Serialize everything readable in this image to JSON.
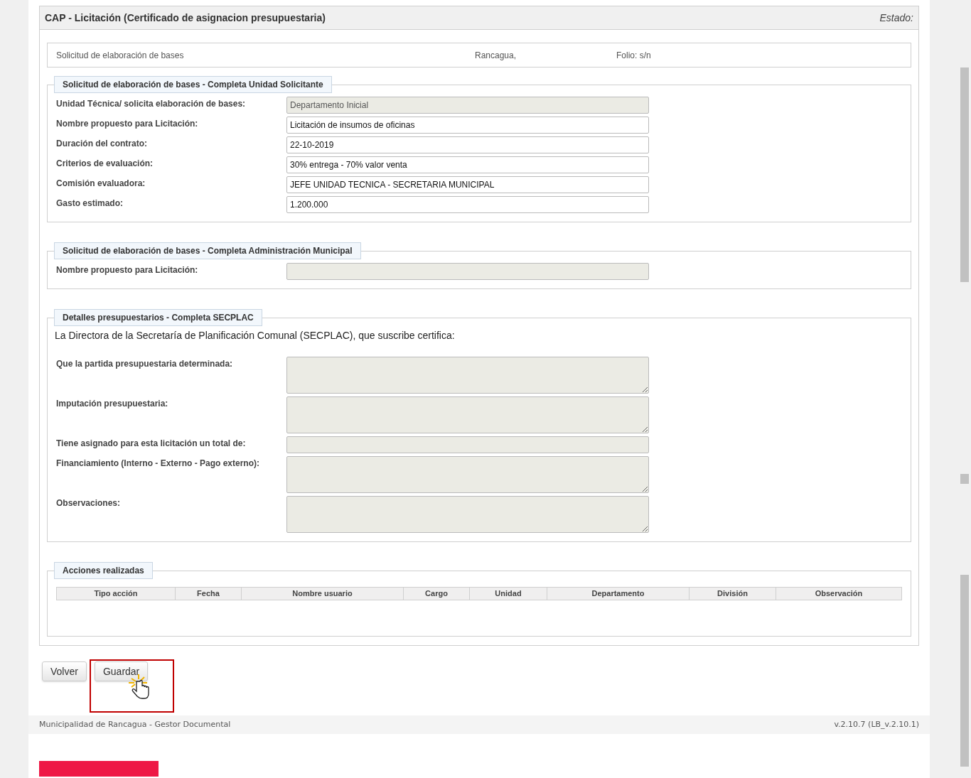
{
  "panel": {
    "title": "CAP - Licitación (Certificado de asignacion presupuestaria)",
    "status_label": "Estado:"
  },
  "header_box": {
    "document": "Solicitud de elaboración de bases",
    "city": "Rancagua,",
    "folio": "Folio: s/n"
  },
  "sections": [
    {
      "legend": "Solicitud de elaboración de bases - Completa Unidad Solicitante",
      "fields": [
        {
          "label": "Unidad Técnica/ solicita elaboración de bases:",
          "kind": "input",
          "disabled": true,
          "value": "Departamento Inicial"
        },
        {
          "label": "Nombre propuesto para Licitación:",
          "kind": "input",
          "disabled": false,
          "value": "Licitación de insumos de oficinas"
        },
        {
          "label": "Duración del contrato:",
          "kind": "input",
          "disabled": false,
          "value": "22-10-2019"
        },
        {
          "label": "Criterios de evaluación:",
          "kind": "input",
          "disabled": false,
          "value": "30% entrega - 70% valor venta"
        },
        {
          "label": "Comisión evaluadora:",
          "kind": "input",
          "disabled": false,
          "value": "JEFE UNIDAD TECNICA - SECRETARIA MUNICIPAL"
        },
        {
          "label": "Gasto estimado:",
          "kind": "input",
          "disabled": false,
          "value": "1.200.000"
        }
      ]
    },
    {
      "legend": "Solicitud de elaboración de bases - Completa Administración Municipal",
      "fields": [
        {
          "label": "Nombre propuesto para Licitación:",
          "kind": "input",
          "disabled": true
        }
      ]
    },
    {
      "legend": "Detalles presupuestarios - Completa SECPLAC",
      "intro": "La Directora de la Secretaría de Planificación Comunal (SECPLAC), que suscribe certifica:",
      "fields": [
        {
          "label": "Que la partida presupuestaria determinada:",
          "kind": "textarea",
          "disabled": true
        },
        {
          "label": "Imputación presupuestaria:",
          "kind": "textarea",
          "disabled": true
        },
        {
          "label": "Tiene asignado para esta licitación un total de:",
          "kind": "input",
          "disabled": true
        },
        {
          "label": "Financiamiento (Interno - Externo - Pago externo):",
          "kind": "textarea",
          "disabled": true
        },
        {
          "label": "Observaciones:",
          "kind": "textarea",
          "disabled": true
        }
      ]
    }
  ],
  "actions": {
    "legend": "Acciones realizadas",
    "columns": [
      "Tipo acción",
      "Fecha",
      "Nombre usuario",
      "Cargo",
      "Unidad",
      "Departamento",
      "División",
      "Observación"
    ]
  },
  "buttons": [
    {
      "label": "Volver",
      "highlighted": false
    },
    {
      "label": "Guardar",
      "highlighted": true
    }
  ],
  "footer": {
    "left": "Municipalidad de Rancagua - Gestor Documental",
    "right": "v.2.10.7 (LB_v.2.10.1)"
  }
}
